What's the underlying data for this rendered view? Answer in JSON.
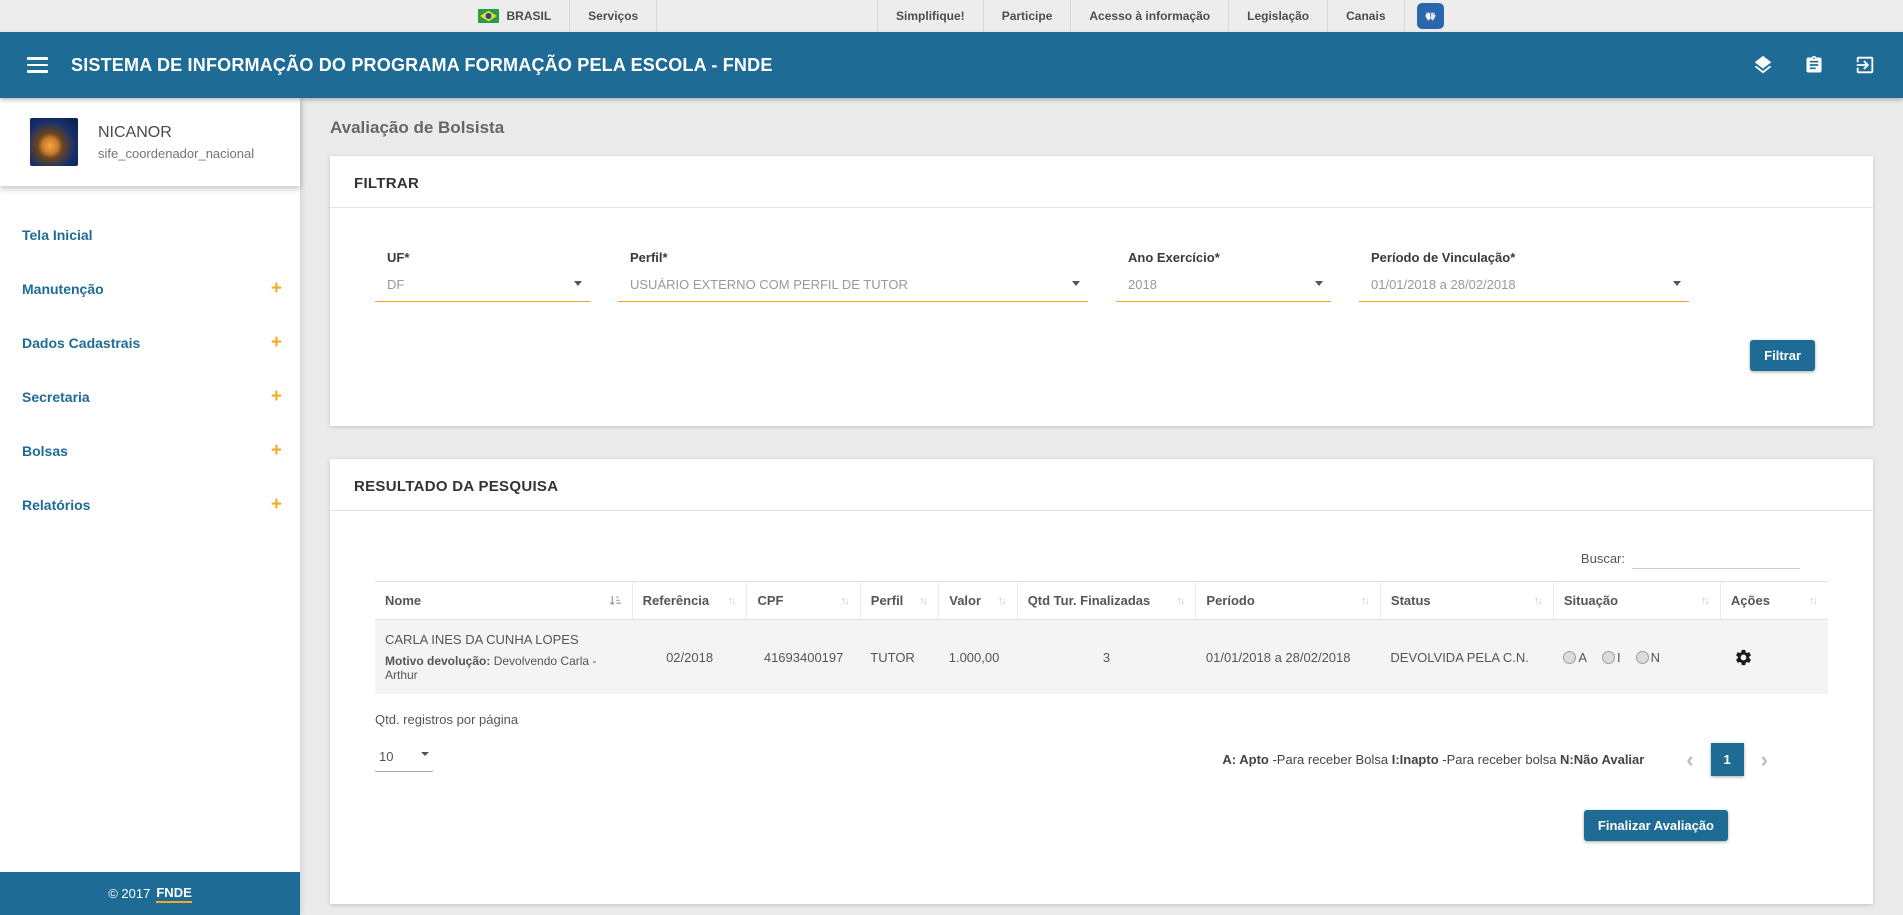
{
  "theme": {
    "primary_blue": "#1e6c96",
    "accent_orange": "#f7a824",
    "vlibras_blue": "#2a66ad"
  },
  "govbar": {
    "brasil": "BRASIL",
    "servicos": "Serviços",
    "right_items": [
      "Simplifique!",
      "Participe",
      "Acesso à informação",
      "Legislação",
      "Canais"
    ]
  },
  "header": {
    "title": "SISTEMA DE INFORMAÇÃO DO PROGRAMA FORMAÇÃO PELA ESCOLA - FNDE"
  },
  "sidebar": {
    "user": {
      "name": "NICANOR",
      "role": "sife_coordenador_nacional"
    },
    "items": [
      {
        "label": "Tela Inicial"
      },
      {
        "label": "Manutenção",
        "plus": "+"
      },
      {
        "label": "Dados Cadastrais",
        "plus": "+"
      },
      {
        "label": "Secretaria",
        "plus": "+"
      },
      {
        "label": "Bolsas",
        "plus": "+"
      },
      {
        "label": "Relatórios",
        "plus": "+"
      }
    ],
    "footer": {
      "copyright": "© 2017",
      "brand": "FNDE"
    }
  },
  "main": {
    "page_title": "Avaliação de Bolsista",
    "filter": {
      "title": "FILTRAR",
      "fields": [
        {
          "label": "UF*",
          "value": "DF"
        },
        {
          "label": "Perfil*",
          "value": "USUÁRIO EXTERNO COM PERFIL DE TUTOR"
        },
        {
          "label": "Ano Exercício*",
          "value": "2018"
        },
        {
          "label": "Período de Vinculação*",
          "value": "01/01/2018 a 28/02/2018"
        }
      ],
      "submit_label": "Filtrar"
    },
    "results": {
      "title": "RESULTADO DA PESQUISA",
      "search_label": "Buscar:",
      "columns": [
        "Nome",
        "Referência",
        "CPF",
        "Perfil",
        "Valor",
        "Qtd Tur. Finalizadas",
        "Período",
        "Status",
        "Situação",
        "Ações"
      ],
      "row": {
        "nome": "CARLA INES DA CUNHA LOPES",
        "motivo_label": "Motivo devolução:",
        "motivo_text": "Devolvendo Carla - Arthur",
        "referencia": "02/2018",
        "cpf": "41693400197",
        "perfil": "TUTOR",
        "valor": "1.000,00",
        "qtd_turmas": "3",
        "periodo": "01/01/2018 a 28/02/2018",
        "status": "DEVOLVIDA PELA C.N.",
        "situacao": [
          "A",
          "I",
          "N"
        ]
      },
      "per_page_label": "Qtd. registros por página",
      "per_page_value": "10",
      "legend": [
        {
          "text": "A: Apto",
          "bold": true
        },
        {
          "text": " -Para receber Bolsa ",
          "bold": false
        },
        {
          "text": "I:Inapto",
          "bold": true
        },
        {
          "text": " -Para receber bolsa ",
          "bold": false
        },
        {
          "text": "N:Não Avaliar",
          "bold": true
        }
      ],
      "page": "1",
      "finalize_label": "Finalizar Avaliação"
    }
  },
  "icons": {
    "sort": "↑↓",
    "chevron_left": "‹",
    "chevron_right": "›"
  }
}
